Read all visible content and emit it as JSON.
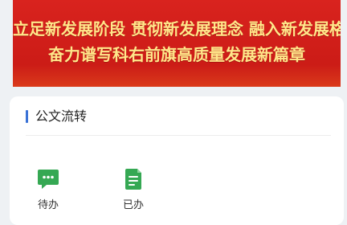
{
  "banner": {
    "line1": "立足新发展阶段 贯彻新发展理念 融入新发展格局",
    "line2": "奋力谱写科右前旗高质量发展新篇章"
  },
  "section": {
    "title": "公文流转"
  },
  "items": [
    {
      "label": "待办",
      "icon": "chat-bubble-icon"
    },
    {
      "label": "已办",
      "icon": "document-icon"
    }
  ],
  "colors": {
    "banner_red": "#d9231e",
    "banner_text": "#ffe78a",
    "accent_blue": "#3a72d6",
    "icon_green": "#35a853"
  }
}
